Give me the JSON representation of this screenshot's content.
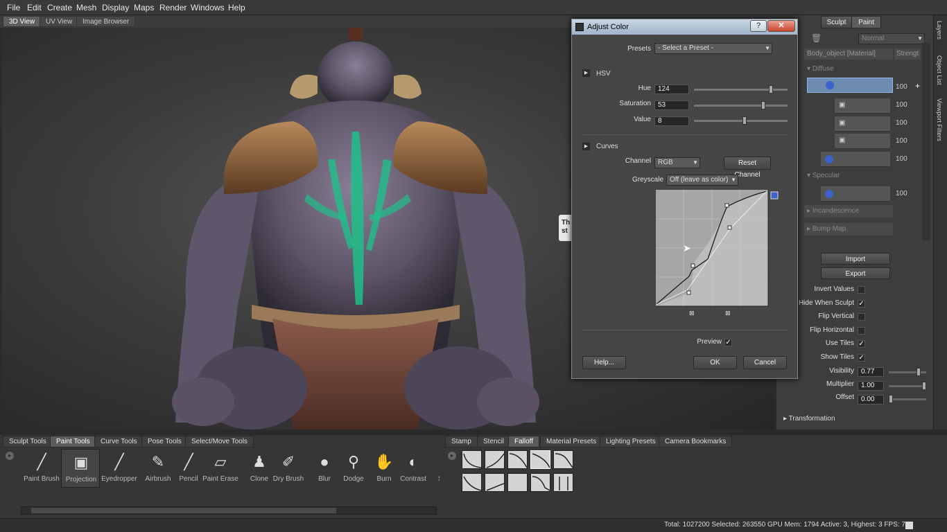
{
  "menu": [
    "File",
    "Edit",
    "Create",
    "Mesh",
    "Display",
    "Maps",
    "Render",
    "Windows",
    "Help"
  ],
  "view_tabs": [
    "3D View",
    "UV View",
    "Image Browser"
  ],
  "right_panel": {
    "mode_tabs": [
      "Sculpt",
      "Paint"
    ],
    "blend_mode": "Normal",
    "layer_header": "Body_object [Material]",
    "strength_header": "Strengt",
    "diffuse_label": "Diffuse",
    "specular_label": "Specular",
    "incandescence_label": "Incandescence",
    "bump_label": "Bump Map",
    "layer_values": [
      "100",
      "100",
      "100",
      "100",
      "100",
      "100"
    ],
    "import_label": "Import",
    "export_label": "Export",
    "options": [
      {
        "label": "Invert Values",
        "checked": ""
      },
      {
        "label": "Hide When Sculpt",
        "checked": "✓"
      },
      {
        "label": "Flip Vertical",
        "checked": ""
      },
      {
        "label": "Flip Horizontal",
        "checked": ""
      },
      {
        "label": "Use Tiles",
        "checked": "✓"
      },
      {
        "label": "Show Tiles",
        "checked": "✓"
      }
    ],
    "visibility_label": "Visibility",
    "visibility_value": "0.77",
    "visibility_level": 0.77,
    "multiplier_label": "Multiplier",
    "multiplier_value": "1.00",
    "offset_label": "Offset",
    "offset_value": "0.00",
    "transformation_label": "Transformation"
  },
  "side_strip": [
    "Layers",
    "Object List",
    "Viewport Filters"
  ],
  "tooltip_fragment": [
    "Th",
    "st"
  ],
  "dialog": {
    "title": "Adjust Color",
    "help_btn": "?",
    "close_btn": "✕",
    "presets_label": "Presets",
    "presets_value": "- Select a Preset -",
    "hsv_label": "HSV",
    "hue_label": "Hue",
    "hue_value": "124",
    "saturation_label": "Saturation",
    "saturation_value": "53",
    "value_label": "Value",
    "value_value": "8",
    "curves_label": "Curves",
    "channel_label": "Channel",
    "channel_value": "RGB",
    "reset_channel": "Reset Channel",
    "greyscale_label": "Greyscale",
    "greyscale_value": "Off (leave as color)",
    "preview_label": "Preview",
    "preview_checked": "✓",
    "help_button": "Help...",
    "ok_button": "OK",
    "cancel_button": "Cancel"
  },
  "bottom": {
    "tool_tabs": [
      "Sculpt Tools",
      "Paint Tools",
      "Curve Tools",
      "Pose Tools",
      "Select/Move Tools"
    ],
    "tools": [
      {
        "label": "Paint Brush",
        "icon": "paint-brush-icon",
        "glyph": "╱"
      },
      {
        "label": "Projection",
        "icon": "projection-icon",
        "glyph": "▣"
      },
      {
        "label": "Eyedropper",
        "icon": "eyedropper-icon",
        "glyph": "╱"
      },
      {
        "label": "Airbrush",
        "icon": "airbrush-icon",
        "glyph": "✎"
      },
      {
        "label": "Pencil",
        "icon": "pencil-icon",
        "glyph": "╱"
      },
      {
        "label": "Paint Erase",
        "icon": "eraser-icon",
        "glyph": "▱"
      },
      {
        "label": "Clone",
        "icon": "clone-stamp-icon",
        "glyph": "♟"
      },
      {
        "label": "Dry Brush",
        "icon": "dry-brush-icon",
        "glyph": "✐"
      },
      {
        "label": "Blur",
        "icon": "blur-drop-icon",
        "glyph": "●"
      },
      {
        "label": "Dodge",
        "icon": "dodge-icon",
        "glyph": "⚲"
      },
      {
        "label": "Burn",
        "icon": "burn-hand-icon",
        "glyph": "✋"
      },
      {
        "label": "Contrast",
        "icon": "contrast-icon",
        "glyph": "◐"
      },
      {
        "label": "Sp",
        "icon": "sponge-icon",
        "glyph": "▪"
      }
    ],
    "stamp_tabs": [
      "Stamp",
      "Stencil",
      "Falloff",
      "Material Presets",
      "Lighting Presets",
      "Camera Bookmarks"
    ]
  },
  "status": {
    "text": "Total: 1027200  Selected: 263550 GPU Mem: 1794  Active: 3, Highest: 3  FPS: 7"
  }
}
